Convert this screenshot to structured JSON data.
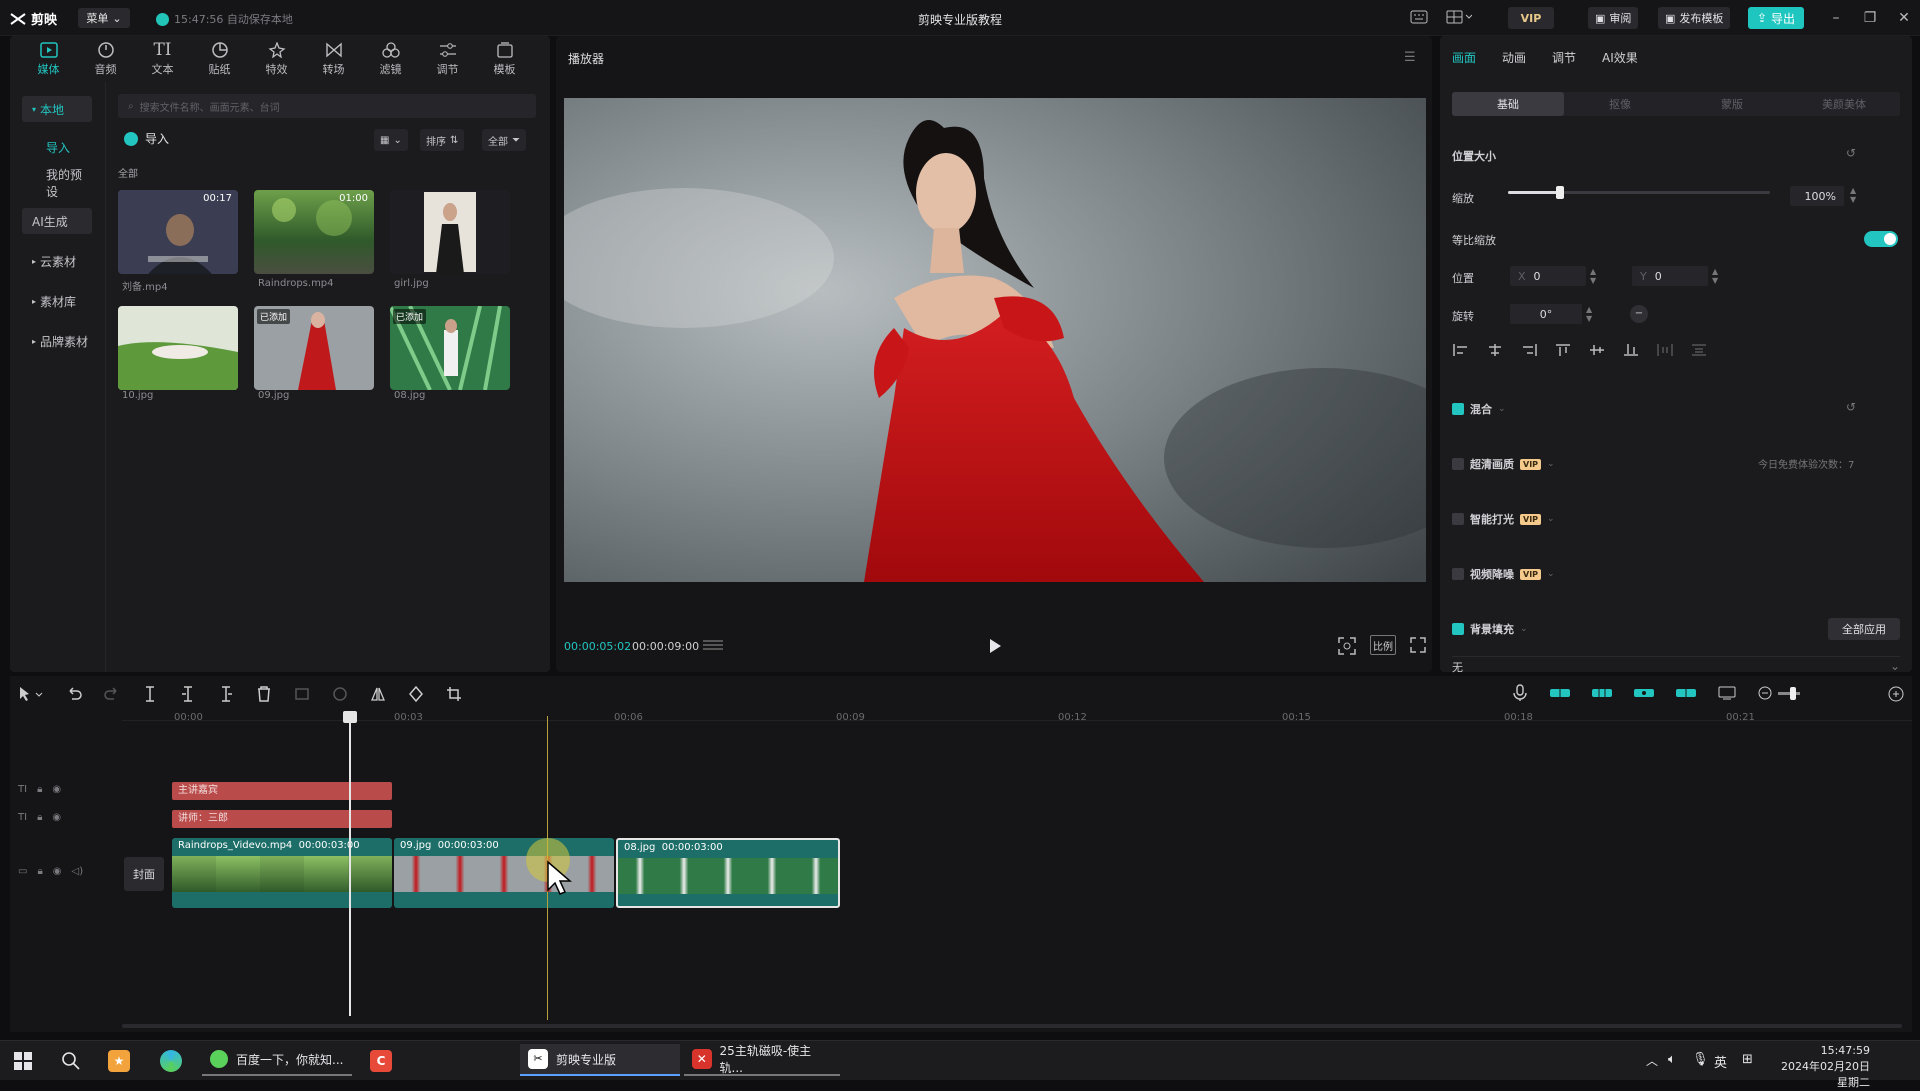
{
  "app": {
    "logo": "剪映",
    "menu": "菜单",
    "autosave": "15:47:56 自动保存本地",
    "title": "剪映专业版教程",
    "vip": "VIP",
    "review": "审阅",
    "publish_template": "发布模板",
    "export": "导出",
    "window_controls": [
      "minimize-icon",
      "restore-icon",
      "close-icon"
    ]
  },
  "toolbar": {
    "tabs": [
      {
        "label": "媒体",
        "icon": "media-icon",
        "active": true
      },
      {
        "label": "音频",
        "icon": "audio-icon"
      },
      {
        "label": "文本",
        "icon": "text-icon"
      },
      {
        "label": "贴纸",
        "icon": "sticker-icon"
      },
      {
        "label": "特效",
        "icon": "effects-icon"
      },
      {
        "label": "转场",
        "icon": "transition-icon"
      },
      {
        "label": "滤镜",
        "icon": "filter-icon"
      },
      {
        "label": "调节",
        "icon": "adjust-icon"
      },
      {
        "label": "模板",
        "icon": "template-icon"
      }
    ]
  },
  "leftnav": {
    "items": [
      {
        "label": "本地",
        "selected": true
      },
      {
        "label": "导入"
      },
      {
        "label": "我的预设"
      },
      {
        "label": "AI生成"
      },
      {
        "label": "云素材"
      },
      {
        "label": "素材库"
      },
      {
        "label": "品牌素材"
      }
    ]
  },
  "media": {
    "search_placeholder": "搜索文件名称、画面元素、台词",
    "import_label": "导入",
    "sort_label": "排序",
    "filter_label": "全部",
    "section_label": "全部",
    "items": [
      {
        "name": "刘备.mp4",
        "duration": "00:17",
        "added": ""
      },
      {
        "name": "Raindrops.mp4",
        "duration": "01:00",
        "added": ""
      },
      {
        "name": "girl.jpg",
        "duration": "",
        "added": ""
      },
      {
        "name": "10.jpg",
        "duration": "",
        "added": ""
      },
      {
        "name": "09.jpg",
        "duration": "",
        "added": "已添加"
      },
      {
        "name": "08.jpg",
        "duration": "",
        "added": "已添加"
      }
    ]
  },
  "player": {
    "title": "播放器",
    "current_time": "00:00:05:02",
    "total_time": "00:00:09:00",
    "ratio_label": "比例"
  },
  "inspector": {
    "tabs": [
      "画面",
      "动画",
      "调节",
      "AI效果"
    ],
    "subtabs": [
      "基础",
      "抠像",
      "蒙版",
      "美颜美体"
    ],
    "position_size": "位置大小",
    "scale_label": "缩放",
    "scale_value": "100%",
    "scale_level": 0.2,
    "proportional_label": "等比缩放",
    "position_label": "位置",
    "x_label": "X",
    "x_value": "0",
    "y_label": "Y",
    "y_value": "0",
    "rotate_label": "旋转",
    "rotate_value": "0°",
    "blend_label": "混合",
    "hd_label": "超清画质",
    "smart_light_label": "智能打光",
    "denoise_label": "视频降噪",
    "vip_badge": "VIP",
    "free_count": "今日免费体验次数：7",
    "bg_fill_label": "背景填充",
    "apply_all": "全部应用",
    "bg_fill_value": "无"
  },
  "timeline": {
    "ruler": [
      "00:00",
      "00:03",
      "00:06",
      "00:09",
      "00:12",
      "00:15",
      "00:18",
      "00:21"
    ],
    "text_clips": [
      "主讲嘉宾",
      "讲师：三郎"
    ],
    "cover_label": "封面",
    "video_clips": [
      {
        "name": "Raindrops_Videvo.mp4",
        "duration": "00:00:03:00"
      },
      {
        "name": "09.jpg",
        "duration": "00:00:03:00"
      },
      {
        "name": "08.jpg",
        "duration": "00:00:03:00"
      }
    ]
  },
  "taskbar": {
    "apps": [
      {
        "label": "百度一下，你就知..."
      },
      {
        "label": "剪映专业版"
      },
      {
        "label": "25主轨磁吸-使主轨..."
      }
    ],
    "ime": "英",
    "time": "15:47:59",
    "date": "2024年02月20日 星期二"
  },
  "colors": {
    "accent": "#22c5c0",
    "text_clip": "#b94b4b",
    "video_clip": "#1d6e68"
  }
}
